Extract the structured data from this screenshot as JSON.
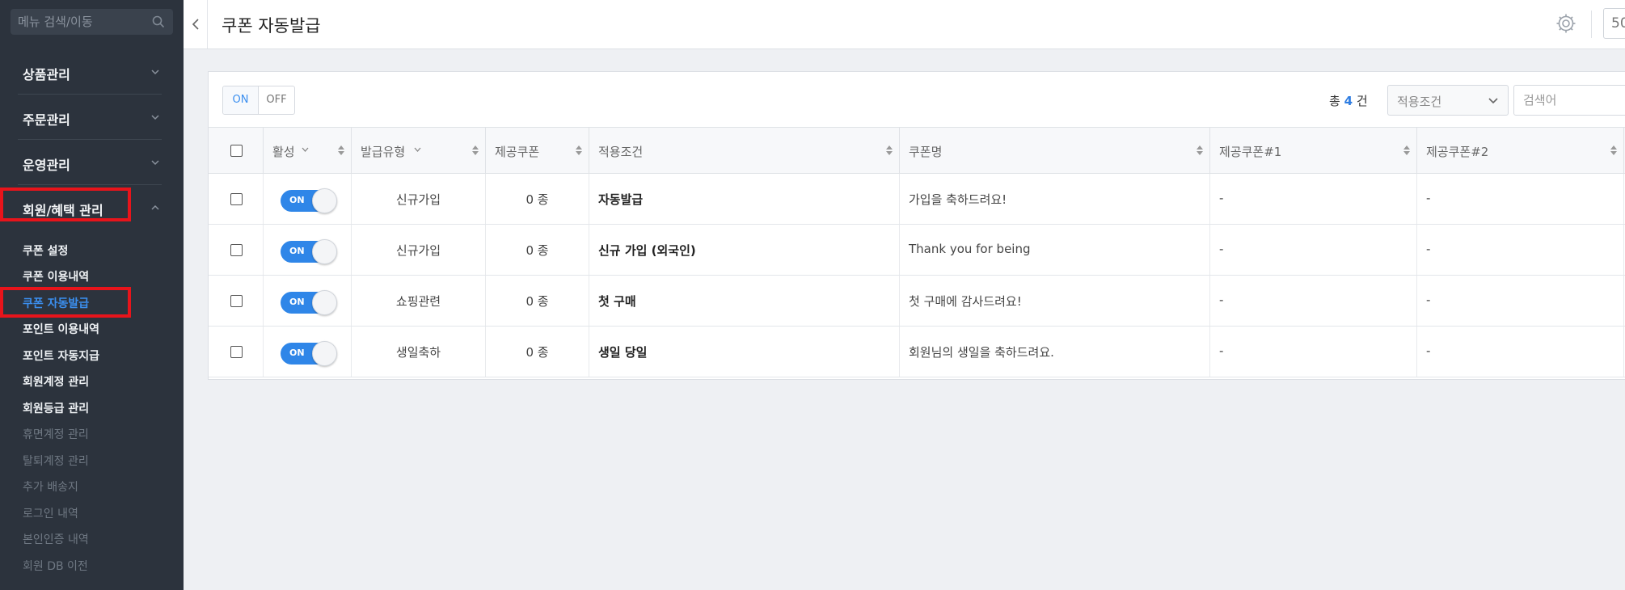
{
  "sidebar": {
    "search_placeholder": "메뉴 검색/이동",
    "groups": [
      {
        "label": "상품관리"
      },
      {
        "label": "주문관리"
      },
      {
        "label": "운영관리"
      },
      {
        "label": "회원/혜택 관리"
      }
    ],
    "sub_items": [
      {
        "label": "쿠폰 설정"
      },
      {
        "label": "쿠폰 이용내역"
      },
      {
        "label": "쿠폰 자동발급"
      },
      {
        "label": "포인트 이용내역"
      },
      {
        "label": "포인트 자동지급"
      },
      {
        "label": "회원계정 관리"
      },
      {
        "label": "회원등급 관리"
      },
      {
        "label": "휴면계정 관리"
      },
      {
        "label": "탈퇴계정 관리"
      },
      {
        "label": "추가 배송지"
      },
      {
        "label": "로그인 내역"
      },
      {
        "label": "본인인증 내역"
      },
      {
        "label": "회원 DB 이전"
      }
    ]
  },
  "header": {
    "title": "쿠폰 자동발급",
    "right_box": "50"
  },
  "toolbar": {
    "on_label": "ON",
    "off_label": "OFF",
    "count_prefix": "총",
    "count_value": "4",
    "count_suffix": "건",
    "condition_select": "적용조건",
    "search_placeholder": "검색어"
  },
  "table": {
    "columns": [
      "활성",
      "발급유형",
      "제공쿠폰",
      "적용조건",
      "쿠폰명",
      "제공쿠폰#1",
      "제공쿠폰#2"
    ],
    "rows": [
      {
        "active": "ON",
        "type": "신규가입",
        "coupons": "0 종",
        "condition": "자동발급",
        "name": "가입을 축하드려요!",
        "c1": "-",
        "c2": "-"
      },
      {
        "active": "ON",
        "type": "신규가입",
        "coupons": "0 종",
        "condition": "신규 가입 (외국인)",
        "name": "Thank you for being",
        "c1": "-",
        "c2": "-"
      },
      {
        "active": "ON",
        "type": "쇼핑관련",
        "coupons": "0 종",
        "condition": "첫 구매",
        "name": "첫 구매에 감사드려요!",
        "c1": "-",
        "c2": "-"
      },
      {
        "active": "ON",
        "type": "생일축하",
        "coupons": "0 종",
        "condition": "생일 당일",
        "name": "회원님의 생일을 축하드려요.",
        "c1": "-",
        "c2": "-"
      }
    ]
  },
  "colors": {
    "sidebar_bg": "#2c333d",
    "accent": "#2f86e8",
    "highlight": "#e8141b"
  },
  "icons": [
    "search-icon",
    "chevron-down-icon",
    "chevron-up-icon",
    "chevron-left-icon",
    "gear-icon",
    "sort-icon"
  ]
}
